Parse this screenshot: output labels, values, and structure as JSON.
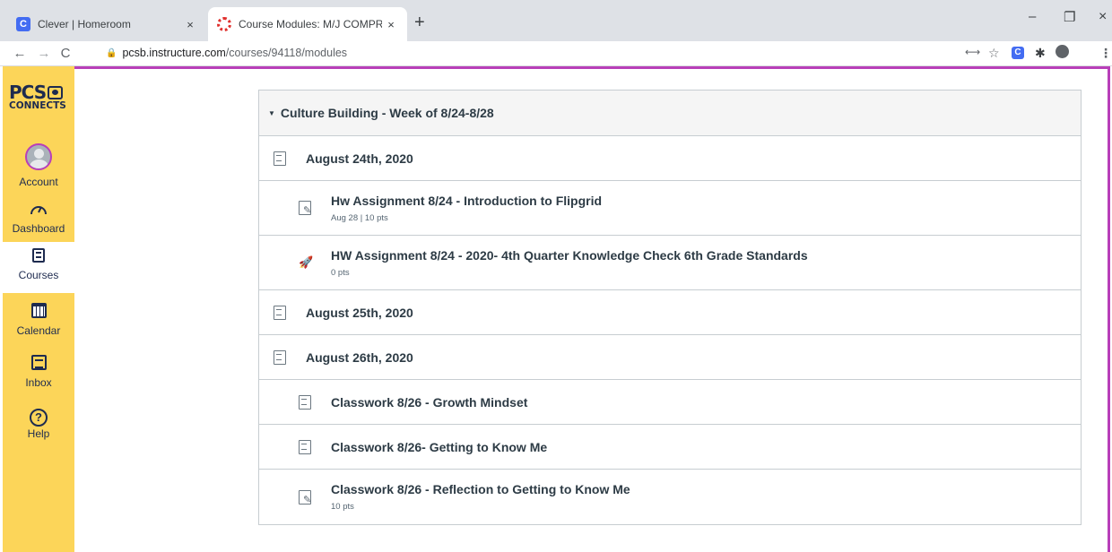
{
  "browser": {
    "tabs": [
      {
        "title": "Clever | Homeroom",
        "favicon": "C"
      },
      {
        "title": "Course Modules: M/J COMPRE SC"
      }
    ],
    "new_tab": "+",
    "close": "×",
    "window_controls": {
      "minimize": "–",
      "restore": "❐",
      "close": "×"
    },
    "url_host": "pcsb.instructure.com",
    "url_path": "/courses/94118/modules"
  },
  "brand": {
    "line1": "PCS",
    "line2": "CONNECTS",
    "accent": "#fcd559",
    "frame": "#b83fb9"
  },
  "nav": {
    "items": [
      {
        "label": "Account"
      },
      {
        "label": "Dashboard"
      },
      {
        "label": "Courses"
      },
      {
        "label": "Calendar"
      },
      {
        "label": "Inbox"
      },
      {
        "label": "Help",
        "icon_text": "?"
      }
    ]
  },
  "module": {
    "title": "Culture Building - Week of 8/24-8/28",
    "rows": [
      {
        "kind": "sub",
        "title": "August 24th, 2020",
        "icon": "document-icon"
      },
      {
        "kind": "item",
        "title": "Hw Assignment 8/24 - Introduction to Flipgrid",
        "meta": "Aug 28  |  10 pts",
        "icon": "assignment-icon"
      },
      {
        "kind": "item",
        "title": "HW Assignment 8/24 - 2020- 4th Quarter Knowledge Check 6th Grade Standards",
        "meta": "0 pts",
        "icon": "quiz-icon"
      },
      {
        "kind": "sub",
        "title": "August 25th, 2020",
        "icon": "document-icon"
      },
      {
        "kind": "sub",
        "title": "August 26th, 2020",
        "icon": "document-icon"
      },
      {
        "kind": "item",
        "title": "Classwork 8/26 - Growth Mindset",
        "icon": "document-icon"
      },
      {
        "kind": "item",
        "title": "Classwork 8/26- Getting to Know Me",
        "icon": "document-icon"
      },
      {
        "kind": "item",
        "title": "Classwork 8/26 - Reflection to Getting to Know Me",
        "meta": "10 pts",
        "icon": "assignment-icon"
      }
    ]
  }
}
